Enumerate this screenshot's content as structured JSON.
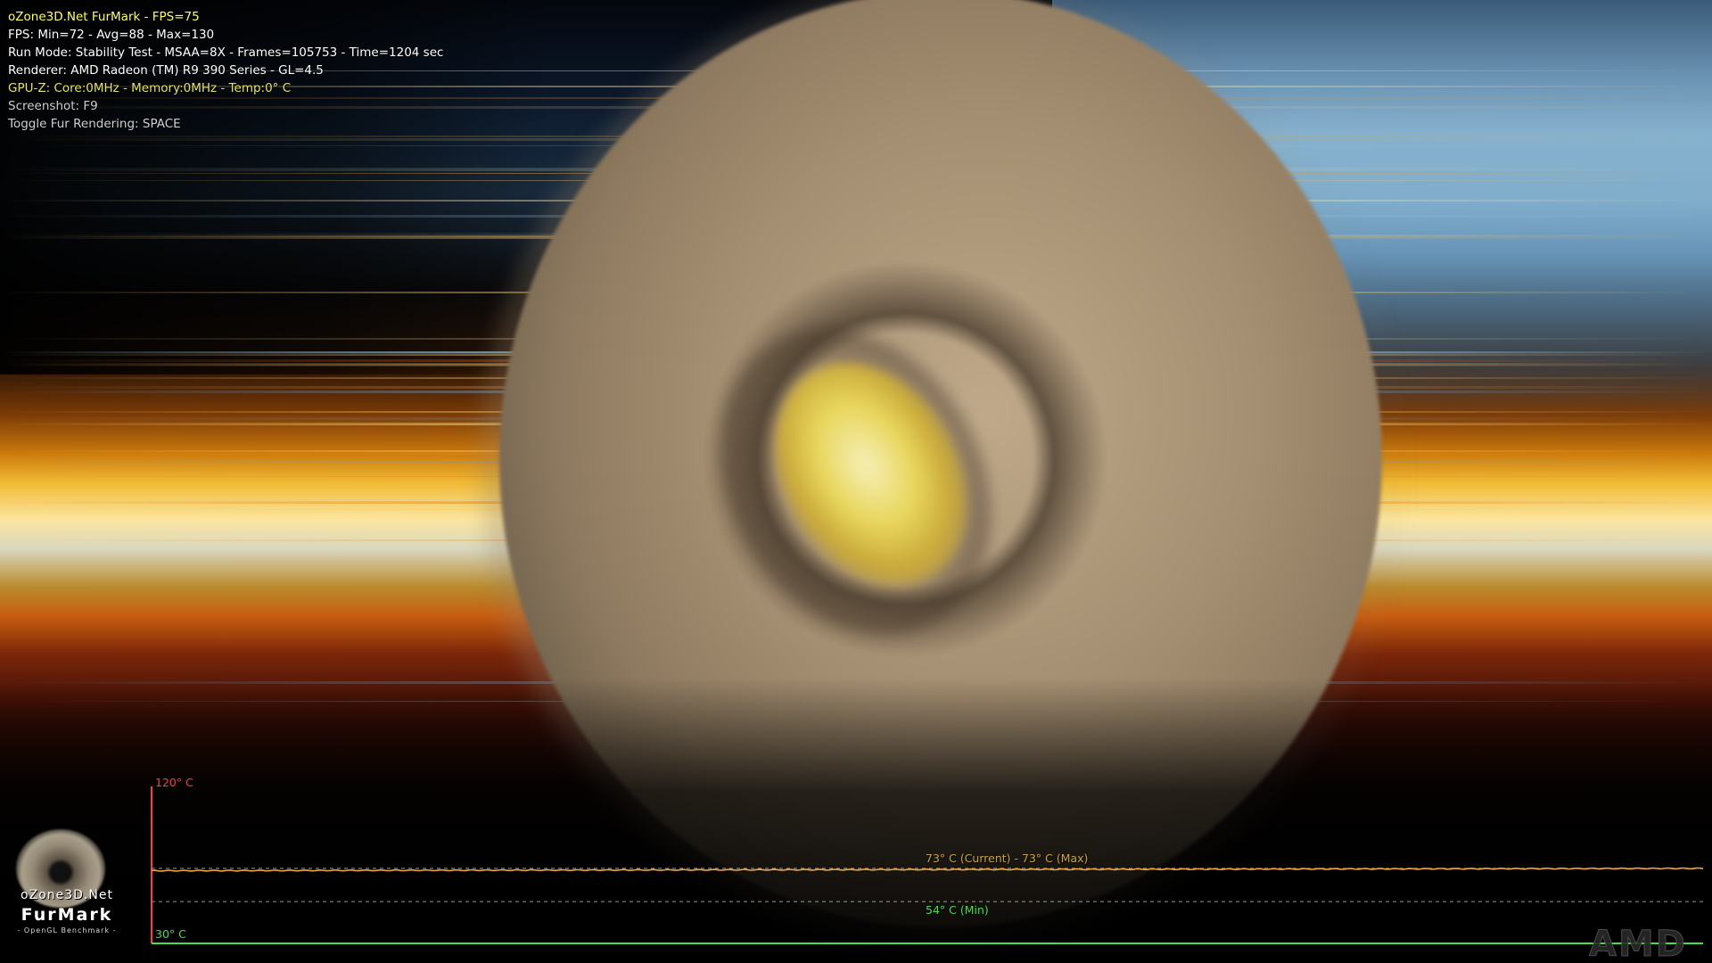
{
  "hud": {
    "title": "oZone3D.Net FurMark - FPS=75",
    "fps_stats": "FPS: Min=72 - Avg=88 - Max=130",
    "run_mode": "Run Mode: Stability Test - MSAA=8X - Frames=105753 - Time=1204 sec",
    "renderer": "Renderer: AMD Radeon (TM) R9 390 Series - GL=4.5",
    "gpuz": "GPU-Z: Core:0MHz - Memory:0MHz - Temp:0° C",
    "screenshot": "Screenshot: F9",
    "toggle": "Toggle Fur Rendering: SPACE"
  },
  "temp_graph": {
    "max_axis_label": "120° C",
    "min_axis_label": "30° C",
    "current_label": "73° C (Current) - 73° C (Max)",
    "min_label": "54° C (Min)",
    "axis_min": 30,
    "axis_max": 120,
    "current_temp": 73,
    "max_temp": 73,
    "min_temp": 54,
    "colors": {
      "max_axis": "#ff3b3b",
      "min_axis": "#48e048",
      "temp_line": "#f0a640",
      "dashed": "#9a9a9a"
    }
  },
  "logo": {
    "line1": "oZone3D.Net",
    "line2": "FurMark",
    "line3": "- OpenGL Benchmark -"
  },
  "watermark": "AMD"
}
